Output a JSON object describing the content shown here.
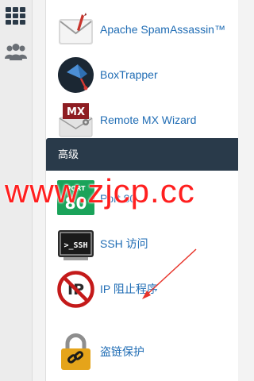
{
  "sidebar": {
    "icons": [
      "grid-icon",
      "users-icon"
    ]
  },
  "email_section": {
    "items": [
      {
        "label": "Apache SpamAssassin™",
        "icon": "spamassassin-icon"
      },
      {
        "label": "BoxTrapper",
        "icon": "boxtrapper-icon"
      },
      {
        "label": "Remote MX Wizard",
        "icon": "remote-mx-icon"
      }
    ]
  },
  "advanced_section": {
    "title": "高级",
    "items": [
      {
        "label": "Port 80",
        "icon": "port80-icon",
        "badge_top": "PORT",
        "badge_num": "80"
      },
      {
        "label": "SSH 访问",
        "icon": "ssh-terminal-icon",
        "badge_text": ">_SSH"
      },
      {
        "label": "IP 阻止程序",
        "icon": "ip-blocker-icon",
        "badge_text": "IP"
      },
      {
        "label": "盗链保护",
        "icon": "hotlink-lock-icon"
      }
    ]
  },
  "watermark": "www.zjcp.cc",
  "colors": {
    "header_bg": "#293a4a",
    "link": "#1f6cb4",
    "watermark": "#ff1f1f",
    "port80_green": "#1aa35a",
    "blocker_red": "#c41a1a",
    "lock_gold": "#e5a41a"
  }
}
